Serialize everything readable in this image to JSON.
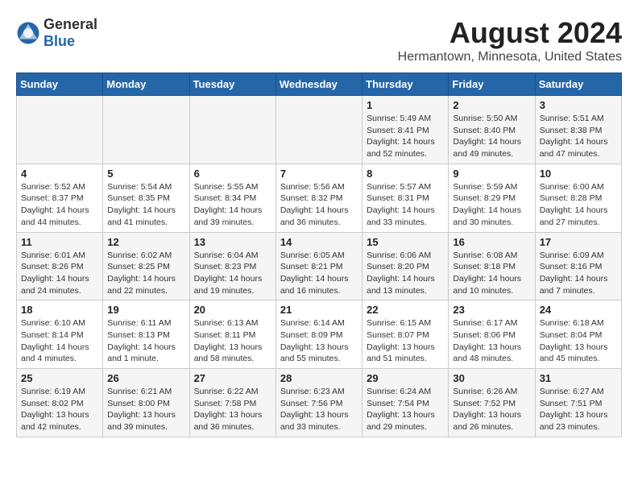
{
  "header": {
    "logo_general": "General",
    "logo_blue": "Blue",
    "month_title": "August 2024",
    "location": "Hermantown, Minnesota, United States"
  },
  "days_of_week": [
    "Sunday",
    "Monday",
    "Tuesday",
    "Wednesday",
    "Thursday",
    "Friday",
    "Saturday"
  ],
  "weeks": [
    [
      {
        "day": "",
        "info": ""
      },
      {
        "day": "",
        "info": ""
      },
      {
        "day": "",
        "info": ""
      },
      {
        "day": "",
        "info": ""
      },
      {
        "day": "1",
        "info": "Sunrise: 5:49 AM\nSunset: 8:41 PM\nDaylight: 14 hours\nand 52 minutes."
      },
      {
        "day": "2",
        "info": "Sunrise: 5:50 AM\nSunset: 8:40 PM\nDaylight: 14 hours\nand 49 minutes."
      },
      {
        "day": "3",
        "info": "Sunrise: 5:51 AM\nSunset: 8:38 PM\nDaylight: 14 hours\nand 47 minutes."
      }
    ],
    [
      {
        "day": "4",
        "info": "Sunrise: 5:52 AM\nSunset: 8:37 PM\nDaylight: 14 hours\nand 44 minutes."
      },
      {
        "day": "5",
        "info": "Sunrise: 5:54 AM\nSunset: 8:35 PM\nDaylight: 14 hours\nand 41 minutes."
      },
      {
        "day": "6",
        "info": "Sunrise: 5:55 AM\nSunset: 8:34 PM\nDaylight: 14 hours\nand 39 minutes."
      },
      {
        "day": "7",
        "info": "Sunrise: 5:56 AM\nSunset: 8:32 PM\nDaylight: 14 hours\nand 36 minutes."
      },
      {
        "day": "8",
        "info": "Sunrise: 5:57 AM\nSunset: 8:31 PM\nDaylight: 14 hours\nand 33 minutes."
      },
      {
        "day": "9",
        "info": "Sunrise: 5:59 AM\nSunset: 8:29 PM\nDaylight: 14 hours\nand 30 minutes."
      },
      {
        "day": "10",
        "info": "Sunrise: 6:00 AM\nSunset: 8:28 PM\nDaylight: 14 hours\nand 27 minutes."
      }
    ],
    [
      {
        "day": "11",
        "info": "Sunrise: 6:01 AM\nSunset: 8:26 PM\nDaylight: 14 hours\nand 24 minutes."
      },
      {
        "day": "12",
        "info": "Sunrise: 6:02 AM\nSunset: 8:25 PM\nDaylight: 14 hours\nand 22 minutes."
      },
      {
        "day": "13",
        "info": "Sunrise: 6:04 AM\nSunset: 8:23 PM\nDaylight: 14 hours\nand 19 minutes."
      },
      {
        "day": "14",
        "info": "Sunrise: 6:05 AM\nSunset: 8:21 PM\nDaylight: 14 hours\nand 16 minutes."
      },
      {
        "day": "15",
        "info": "Sunrise: 6:06 AM\nSunset: 8:20 PM\nDaylight: 14 hours\nand 13 minutes."
      },
      {
        "day": "16",
        "info": "Sunrise: 6:08 AM\nSunset: 8:18 PM\nDaylight: 14 hours\nand 10 minutes."
      },
      {
        "day": "17",
        "info": "Sunrise: 6:09 AM\nSunset: 8:16 PM\nDaylight: 14 hours\nand 7 minutes."
      }
    ],
    [
      {
        "day": "18",
        "info": "Sunrise: 6:10 AM\nSunset: 8:14 PM\nDaylight: 14 hours\nand 4 minutes."
      },
      {
        "day": "19",
        "info": "Sunrise: 6:11 AM\nSunset: 8:13 PM\nDaylight: 14 hours\nand 1 minute."
      },
      {
        "day": "20",
        "info": "Sunrise: 6:13 AM\nSunset: 8:11 PM\nDaylight: 13 hours\nand 58 minutes."
      },
      {
        "day": "21",
        "info": "Sunrise: 6:14 AM\nSunset: 8:09 PM\nDaylight: 13 hours\nand 55 minutes."
      },
      {
        "day": "22",
        "info": "Sunrise: 6:15 AM\nSunset: 8:07 PM\nDaylight: 13 hours\nand 51 minutes."
      },
      {
        "day": "23",
        "info": "Sunrise: 6:17 AM\nSunset: 8:06 PM\nDaylight: 13 hours\nand 48 minutes."
      },
      {
        "day": "24",
        "info": "Sunrise: 6:18 AM\nSunset: 8:04 PM\nDaylight: 13 hours\nand 45 minutes."
      }
    ],
    [
      {
        "day": "25",
        "info": "Sunrise: 6:19 AM\nSunset: 8:02 PM\nDaylight: 13 hours\nand 42 minutes."
      },
      {
        "day": "26",
        "info": "Sunrise: 6:21 AM\nSunset: 8:00 PM\nDaylight: 13 hours\nand 39 minutes."
      },
      {
        "day": "27",
        "info": "Sunrise: 6:22 AM\nSunset: 7:58 PM\nDaylight: 13 hours\nand 36 minutes."
      },
      {
        "day": "28",
        "info": "Sunrise: 6:23 AM\nSunset: 7:56 PM\nDaylight: 13 hours\nand 33 minutes."
      },
      {
        "day": "29",
        "info": "Sunrise: 6:24 AM\nSunset: 7:54 PM\nDaylight: 13 hours\nand 29 minutes."
      },
      {
        "day": "30",
        "info": "Sunrise: 6:26 AM\nSunset: 7:52 PM\nDaylight: 13 hours\nand 26 minutes."
      },
      {
        "day": "31",
        "info": "Sunrise: 6:27 AM\nSunset: 7:51 PM\nDaylight: 13 hours\nand 23 minutes."
      }
    ]
  ]
}
